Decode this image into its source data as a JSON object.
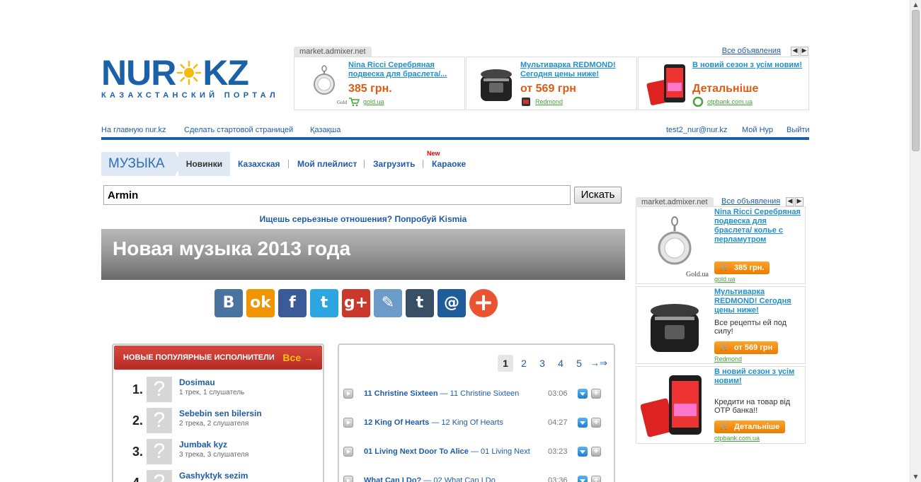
{
  "logo": {
    "left": "NUR",
    "right": "KZ",
    "tagline": "КАЗАХСТАНСКИЙ ПОРТАЛ"
  },
  "top_ads": {
    "source": "market.admixer.net",
    "all_label": "Все объявления",
    "items": [
      {
        "title": "Nina Ricci Серебряная подвеска для браслета/...",
        "price": "385 грн.",
        "domain": "gold.ua",
        "brand": "Gold.ua"
      },
      {
        "title": "Мультиварка REDMOND! Сегодня цены ниже!",
        "price": "от 569 грн",
        "domain": "Redmond"
      },
      {
        "title": "В новий сезон з усім новим!",
        "price": "Детальніше",
        "domain": "otpbank.com.ua"
      }
    ]
  },
  "topnav": {
    "home": "На главную nur.kz",
    "start_page": "Сделать стартовой страницей",
    "kazakh": "Қазақша",
    "email": "test2_nur@nur.kz",
    "my_nur": "Мой Нур",
    "logout": "Выйти"
  },
  "music_menu": {
    "section": "МУЗЫКА",
    "items": [
      "Новинки",
      "Казахская",
      "Мой плейлист",
      "Загрузить",
      "Караоке"
    ],
    "new_badge": "New"
  },
  "search": {
    "value": "Armin",
    "button": "Искать"
  },
  "promo": "Ищешь серьезные отношения? Попробуй Kismia",
  "banner_title": "Новая музыка 2013 года",
  "share_icons": [
    "vk-icon",
    "odnoklassniki-icon",
    "facebook-icon",
    "twitter-icon",
    "googleplus-icon",
    "livejournal-icon",
    "tumblr-icon",
    "mailru-icon",
    "more-icon"
  ],
  "artists": {
    "header": "НОВЫЕ ПОПУЛЯРНЫЕ ИСПОЛНИТЕЛИ",
    "all_label": "Все →",
    "items": [
      {
        "rank": "1.",
        "name": "Dosimau",
        "stats": "1 трек, 1 слушатель"
      },
      {
        "rank": "2.",
        "name": "Sebebin sen bilersin",
        "stats": "2 трека, 2 слушателя"
      },
      {
        "rank": "3.",
        "name": "Jumbak kyz",
        "stats": "3 трека, 3 слушателя"
      },
      {
        "rank": "4.",
        "name": "Gashyktyk sezim",
        "stats": ""
      }
    ]
  },
  "tracks": {
    "pages": [
      "1",
      "2",
      "3",
      "4",
      "5"
    ],
    "next": "→⇒",
    "items": [
      {
        "artist": "11 Christine Sixteen",
        "title": "— 11 Christine Sixteen",
        "duration": "03:06"
      },
      {
        "artist": "12 King Of Hearts",
        "title": "— 12 King Of Hearts",
        "duration": "04:27"
      },
      {
        "artist": "01 Living Next Door To Alice",
        "title": "— 01 Living Next",
        "duration": "03:23"
      },
      {
        "artist": "What Can I Do?",
        "title": "— 02 What Can I Do",
        "duration": "03:36"
      }
    ]
  },
  "right_ads": {
    "source": "market.admixer.net",
    "all_label": "Все объявления",
    "items": [
      {
        "title": "Nina Ricci Серебряная подвеска для браслета/ колье с перламутром",
        "desc": "",
        "button": "385 грн.",
        "domain": "gold.ua",
        "brand": "Gold.ua"
      },
      {
        "title": "Мультиварка REDMOND! Сегодня цены ниже!",
        "desc": "Все рецепты ей под силу!",
        "button": "от 569 грн",
        "domain": "Redmond"
      },
      {
        "title": "В новий сезон з усім новим!",
        "desc": "Кредити на товар від ОТР банка!!",
        "button": "Детальніше",
        "domain": "otpbank.com.ua"
      }
    ]
  },
  "colors": {
    "brand_blue": "#1b61a8",
    "link": "#1f5ca8",
    "ad_link": "#1f8fd0",
    "price": "#e25a12",
    "header_red": "#c8352e",
    "button_orange": "#f28b0c"
  }
}
